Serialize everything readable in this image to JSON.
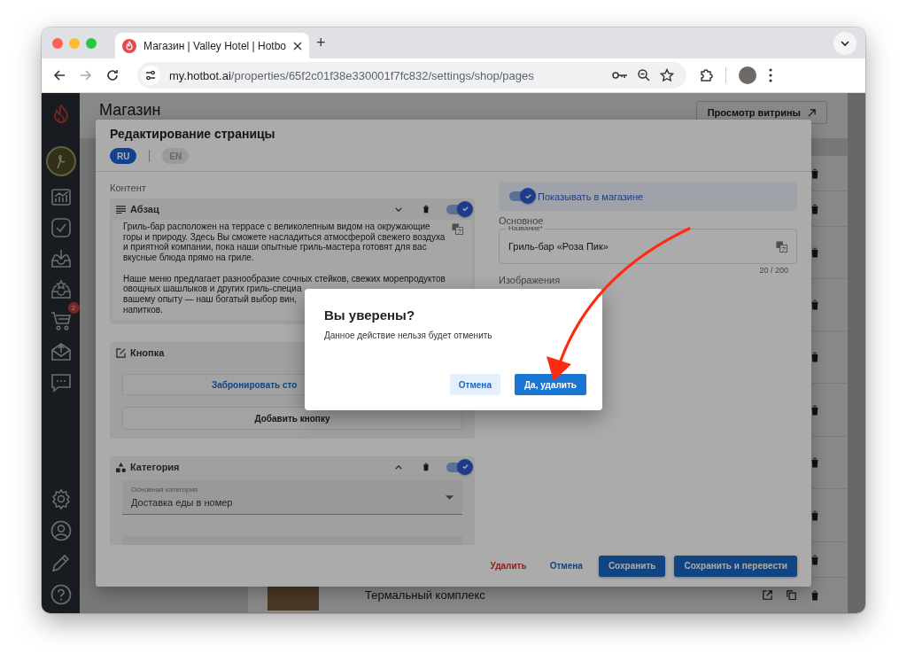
{
  "browser": {
    "tab_title": "Магазин | Valley Hotel | Hotbo",
    "new_tab": "+",
    "url_host": "my.hotbot.ai",
    "url_path": "/properties/65f2c01f38e330001f7fc832/settings/shop/pages"
  },
  "sidebar": {
    "cart_badge": "2"
  },
  "page": {
    "title": "Магазин",
    "storefront_button": "Просмотр витрины",
    "last_row": {
      "name": "Термальный комплекс"
    }
  },
  "modal": {
    "title": "Редактирование страницы",
    "languages": [
      {
        "label": "RU",
        "selected": true
      },
      {
        "label": "EN",
        "selected": false
      }
    ],
    "content_label": "Контент",
    "blocks": [
      {
        "kind": "paragraph",
        "title": "Абзац",
        "expanded": false,
        "enabled": true,
        "paragraphs": [
          [
            "Гриль-бар расположен на террасе с великолепным видом на окружающие",
            "горы и природу. Здесь Вы сможете насладиться атмосферой свежего воздуха",
            "и приятной компании, пока наши опытные гриль-мастера готовят для вас",
            "вкусные блюда прямо на гриле."
          ],
          [
            "Наше меню предлагает разнообразие сочных стейков, свежих морепродуктов",
            "овощных шашлыков и других гриль-специа",
            "вашему опыту — наш богатый выбор вин,",
            "напитков."
          ]
        ]
      },
      {
        "kind": "button",
        "title": "Кнопка",
        "buttons": [
          "Забронировать сто"
        ],
        "add_label": "Добавить кнопку"
      },
      {
        "kind": "category",
        "title": "Категория",
        "expanded": true,
        "enabled": true,
        "field": {
          "label": "Основная категория",
          "value": "Доставка еды в номер"
        }
      }
    ],
    "show_in_shop": {
      "label": "Показывать в магазине",
      "on": true
    },
    "main_label": "Основное",
    "name_field": {
      "label": "Название*",
      "value": "Гриль-бар «Роза Пик»",
      "counter": "20 / 200"
    },
    "images_label": "Изображения",
    "footer": {
      "delete": "Удалить",
      "cancel": "Отмена",
      "save": "Сохранить",
      "save_translate": "Сохранить и перевести"
    }
  },
  "dialog": {
    "title": "Вы уверены?",
    "message": "Данное действие нельзя будет отменить",
    "cancel": "Отмена",
    "confirm": "Да, удалить"
  }
}
